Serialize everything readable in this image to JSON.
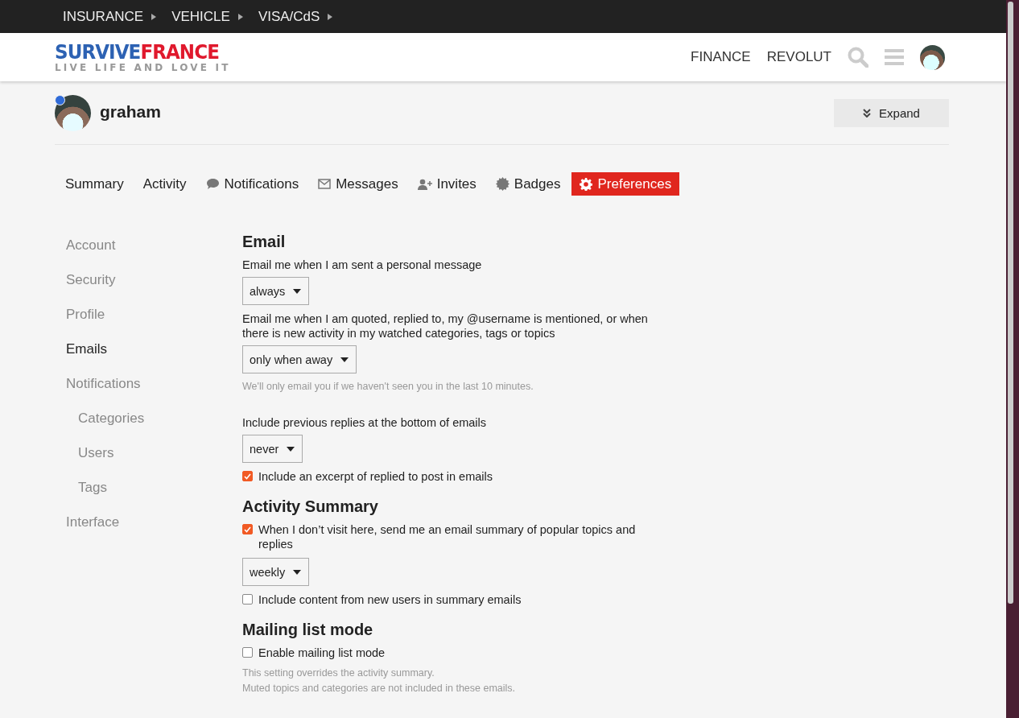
{
  "top_nav": [
    {
      "label": "INSURANCE"
    },
    {
      "label": "VEHICLE"
    },
    {
      "label": "VISA/CdS"
    }
  ],
  "header": {
    "logo": {
      "first": "SURVIVE",
      "second": "FRANCE",
      "tagline": "LIVE LIFE AND LOVE IT"
    },
    "links": [
      "FINANCE",
      "REVOLUT"
    ]
  },
  "user": {
    "name": "graham",
    "expand_button": "Expand"
  },
  "tabs": [
    {
      "label": "Summary",
      "selected": false
    },
    {
      "label": "Activity",
      "selected": false
    },
    {
      "label": "Notifications",
      "selected": false
    },
    {
      "label": "Messages",
      "selected": false
    },
    {
      "label": "Invites",
      "selected": false
    },
    {
      "label": "Badges",
      "selected": false
    },
    {
      "label": "Preferences",
      "selected": true
    }
  ],
  "sidebar": {
    "items": [
      {
        "label": "Account",
        "selected": false
      },
      {
        "label": "Security",
        "selected": false
      },
      {
        "label": "Profile",
        "selected": false
      },
      {
        "label": "Emails",
        "selected": true
      },
      {
        "label": "Notifications",
        "selected": false,
        "children": [
          {
            "label": "Categories",
            "selected": false
          },
          {
            "label": "Users",
            "selected": false
          },
          {
            "label": "Tags",
            "selected": false
          }
        ]
      },
      {
        "label": "Interface",
        "selected": false
      }
    ]
  },
  "sections": [
    {
      "title": "Email",
      "items": [
        {
          "kind": "label",
          "text": "Email me when I am sent a personal message"
        },
        {
          "kind": "select",
          "value": "always"
        },
        {
          "kind": "label",
          "text": "Email me when I am quoted, replied to, my @username is mentioned, or when there is new activity in my watched categories, tags or topics"
        },
        {
          "kind": "select",
          "value": "only when away"
        },
        {
          "kind": "hint",
          "text": "We'll only email you if we haven't seen you in the last 10 minutes."
        },
        {
          "kind": "label",
          "text": "Include previous replies at the bottom of emails"
        },
        {
          "kind": "select",
          "value": "never"
        },
        {
          "kind": "checkbox",
          "text": "Include an excerpt of replied to post in emails",
          "checked": true
        }
      ]
    },
    {
      "title": "Activity Summary",
      "items": [
        {
          "kind": "checkbox",
          "text": "When I don’t visit here, send me an email summary of popular topics and replies",
          "checked": true
        },
        {
          "kind": "select",
          "value": "weekly"
        },
        {
          "kind": "checkbox",
          "text": "Include content from new users in summary emails",
          "checked": false
        }
      ]
    },
    {
      "title": "Mailing list mode",
      "items": [
        {
          "kind": "checkbox",
          "text": "Enable mailing list mode",
          "checked": false
        },
        {
          "kind": "hint",
          "text": "This setting overrides the activity summary."
        },
        {
          "kind": "hint",
          "text": "Muted topics and categories are not included in these emails."
        }
      ]
    }
  ]
}
